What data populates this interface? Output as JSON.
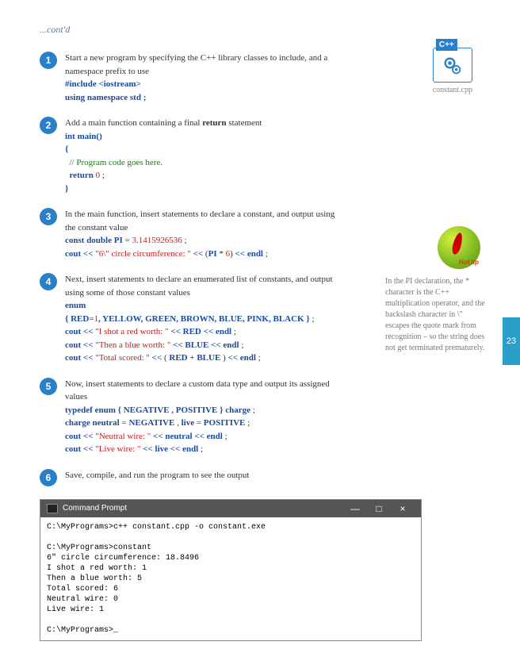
{
  "contd": "...cont'd",
  "steps": [
    {
      "num": "1",
      "text": "Start a new program by specifying the C++ library classes to include, and a namespace prefix to use",
      "code": [
        {
          "t": "kw",
          "v": "#include <iostream>"
        },
        {
          "t": "br"
        },
        {
          "t": "kw",
          "v": "using namespace std ;"
        }
      ]
    },
    {
      "num": "2",
      "text": "Add a main function containing a final ",
      "bold": "return",
      "text2": " statement",
      "code": [
        {
          "t": "kw",
          "v": "int main()"
        },
        {
          "t": "br"
        },
        {
          "t": "kw",
          "v": "{"
        },
        {
          "t": "br"
        },
        {
          "t": "sp"
        },
        {
          "t": "cmt",
          "v": "// Program code goes here."
        },
        {
          "t": "br"
        },
        {
          "t": "sp"
        },
        {
          "t": "kw",
          "v": "return"
        },
        {
          "t": "plain",
          "v": " "
        },
        {
          "t": "num-lit",
          "v": "0"
        },
        {
          "t": "plain",
          "v": " ;"
        },
        {
          "t": "br"
        },
        {
          "t": "kw",
          "v": "}"
        }
      ]
    },
    {
      "num": "3",
      "text": "In the main function, insert statements to declare a constant, and output using the constant value",
      "code": [
        {
          "t": "kw",
          "v": "const double PI"
        },
        {
          "t": "plain",
          "v": " = "
        },
        {
          "t": "num-lit",
          "v": "3.1415926536"
        },
        {
          "t": "plain",
          "v": " ;"
        },
        {
          "t": "br"
        },
        {
          "t": "kw",
          "v": "cout"
        },
        {
          "t": "plain",
          "v": " "
        },
        {
          "t": "op",
          "v": "<<"
        },
        {
          "t": "plain",
          "v": " "
        },
        {
          "t": "str",
          "v": "\"6\\\" circle circumference: \""
        },
        {
          "t": "plain",
          "v": " "
        },
        {
          "t": "op",
          "v": "<<"
        },
        {
          "t": "plain",
          "v": " ("
        },
        {
          "t": "kw",
          "v": "PI"
        },
        {
          "t": "plain",
          "v": " * "
        },
        {
          "t": "num-lit",
          "v": "6"
        },
        {
          "t": "plain",
          "v": ") "
        },
        {
          "t": "op",
          "v": "<<"
        },
        {
          "t": "plain",
          "v": " "
        },
        {
          "t": "kw",
          "v": "endl"
        },
        {
          "t": "plain",
          "v": " ;"
        }
      ]
    },
    {
      "num": "4",
      "text": "Next, insert statements to declare an enumerated list of constants, and output using some of those constant values",
      "code": [
        {
          "t": "kw",
          "v": "enum"
        },
        {
          "t": "br"
        },
        {
          "t": "kw",
          "v": "{ RED"
        },
        {
          "t": "plain",
          "v": "="
        },
        {
          "t": "num-lit",
          "v": "1"
        },
        {
          "t": "kw",
          "v": ", YELLOW, GREEN, BROWN, BLUE, PINK, BLACK }"
        },
        {
          "t": "plain",
          "v": " ;"
        },
        {
          "t": "br"
        },
        {
          "t": "kw",
          "v": "cout"
        },
        {
          "t": "plain",
          "v": " "
        },
        {
          "t": "op",
          "v": "<<"
        },
        {
          "t": "plain",
          "v": " "
        },
        {
          "t": "str",
          "v": "\"I shot a red worth: \""
        },
        {
          "t": "plain",
          "v": " "
        },
        {
          "t": "op",
          "v": "<<"
        },
        {
          "t": "plain",
          "v": " "
        },
        {
          "t": "kw",
          "v": "RED"
        },
        {
          "t": "plain",
          "v": " "
        },
        {
          "t": "op",
          "v": "<<"
        },
        {
          "t": "plain",
          "v": " "
        },
        {
          "t": "kw",
          "v": "endl"
        },
        {
          "t": "plain",
          "v": " ;"
        },
        {
          "t": "br"
        },
        {
          "t": "kw",
          "v": "cout"
        },
        {
          "t": "plain",
          "v": " "
        },
        {
          "t": "op",
          "v": "<<"
        },
        {
          "t": "plain",
          "v": " "
        },
        {
          "t": "str",
          "v": "\"Then a blue worth: \""
        },
        {
          "t": "plain",
          "v": " "
        },
        {
          "t": "op",
          "v": "<<"
        },
        {
          "t": "plain",
          "v": " "
        },
        {
          "t": "kw",
          "v": "BLUE"
        },
        {
          "t": "plain",
          "v": " "
        },
        {
          "t": "op",
          "v": "<<"
        },
        {
          "t": "plain",
          "v": " "
        },
        {
          "t": "kw",
          "v": "endl"
        },
        {
          "t": "plain",
          "v": " ;"
        },
        {
          "t": "br"
        },
        {
          "t": "kw",
          "v": "cout"
        },
        {
          "t": "plain",
          "v": " "
        },
        {
          "t": "op",
          "v": "<<"
        },
        {
          "t": "plain",
          "v": " "
        },
        {
          "t": "str",
          "v": "\"Total scored: \""
        },
        {
          "t": "plain",
          "v": " "
        },
        {
          "t": "op",
          "v": "<<"
        },
        {
          "t": "plain",
          "v": " ( "
        },
        {
          "t": "kw",
          "v": "RED"
        },
        {
          "t": "plain",
          "v": " + "
        },
        {
          "t": "kw",
          "v": "BLUE"
        },
        {
          "t": "plain",
          "v": " ) "
        },
        {
          "t": "op",
          "v": "<<"
        },
        {
          "t": "plain",
          "v": " "
        },
        {
          "t": "kw",
          "v": "endl"
        },
        {
          "t": "plain",
          "v": " ;"
        }
      ]
    },
    {
      "num": "5",
      "text": "Now, insert statements to declare a custom data type and output its assigned values",
      "code": [
        {
          "t": "kw",
          "v": "typedef enum { NEGATIVE , POSITIVE } charge"
        },
        {
          "t": "plain",
          "v": " ;"
        },
        {
          "t": "br"
        },
        {
          "t": "kw",
          "v": "charge neutral"
        },
        {
          "t": "plain",
          "v": " = "
        },
        {
          "t": "kw",
          "v": "NEGATIVE"
        },
        {
          "t": "plain",
          "v": " , "
        },
        {
          "t": "kw",
          "v": "live"
        },
        {
          "t": "plain",
          "v": " = "
        },
        {
          "t": "kw",
          "v": "POSITIVE"
        },
        {
          "t": "plain",
          "v": " ;"
        },
        {
          "t": "br"
        },
        {
          "t": "kw",
          "v": "cout"
        },
        {
          "t": "plain",
          "v": " "
        },
        {
          "t": "op",
          "v": "<<"
        },
        {
          "t": "plain",
          "v": " "
        },
        {
          "t": "str",
          "v": "\"Neutral wire: \""
        },
        {
          "t": "plain",
          "v": " "
        },
        {
          "t": "op",
          "v": "<<"
        },
        {
          "t": "plain",
          "v": " "
        },
        {
          "t": "kw",
          "v": "neutral"
        },
        {
          "t": "plain",
          "v": " "
        },
        {
          "t": "op",
          "v": "<<"
        },
        {
          "t": "plain",
          "v": " "
        },
        {
          "t": "kw",
          "v": "endl"
        },
        {
          "t": "plain",
          "v": " ;"
        },
        {
          "t": "br"
        },
        {
          "t": "kw",
          "v": "cout"
        },
        {
          "t": "plain",
          "v": " "
        },
        {
          "t": "op",
          "v": "<<"
        },
        {
          "t": "plain",
          "v": " "
        },
        {
          "t": "str",
          "v": "\"Live wire: \""
        },
        {
          "t": "plain",
          "v": " "
        },
        {
          "t": "op",
          "v": "<<"
        },
        {
          "t": "plain",
          "v": " "
        },
        {
          "t": "kw",
          "v": "live"
        },
        {
          "t": "plain",
          "v": " "
        },
        {
          "t": "op",
          "v": "<<"
        },
        {
          "t": "plain",
          "v": " "
        },
        {
          "t": "kw",
          "v": "endl"
        },
        {
          "t": "plain",
          "v": " ;"
        }
      ]
    },
    {
      "num": "6",
      "text": "Save, compile, and run the program to see the output",
      "code": []
    }
  ],
  "file": {
    "lang": "C++",
    "name": "constant.cpp"
  },
  "tip": {
    "label": "Hot tip",
    "text": "In the PI declaration, the * character is the C++ multiplication operator, and the backslash character in \\\" escapes the quote mark from recognition – so the string does not get terminated prematurely."
  },
  "pageNum": "23",
  "cmd": {
    "title": "Command Prompt",
    "min": "—",
    "max": "□",
    "close": "×",
    "body": "C:\\MyPrograms>c++ constant.cpp -o constant.exe\n\nC:\\MyPrograms>constant\n6\" circle circumference: 18.8496\nI shot a red worth: 1\nThen a blue worth: 5\nTotal scored: 6\nNeutral wire: 0\nLive wire: 1\n\nC:\\MyPrograms>_"
  }
}
